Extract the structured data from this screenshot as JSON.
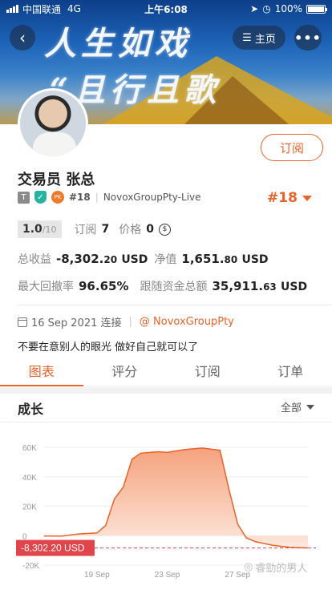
{
  "status_bar": {
    "carrier": "中国联通",
    "network": "4G",
    "time": "上午6:08",
    "battery": "100%"
  },
  "banner": {
    "line1": "人生如戏",
    "line2": "“且行且歌"
  },
  "nav": {
    "home_label": "主页"
  },
  "profile": {
    "subscribe_label": "订阅",
    "name": "交易员  张总",
    "badge_t": "T",
    "badge_pk": "PK",
    "rank_small": "#18",
    "account_type": "NovoxGroupPty-Live",
    "rank_big": "#18"
  },
  "stats": {
    "score": "1.0",
    "score_max": "/10",
    "subscribe_label": "订阅",
    "subscribe_count": "7",
    "price_label": "价格",
    "price_value": "0",
    "total_profit_label": "总收益",
    "total_profit_main": "-8,302.",
    "total_profit_dec": "20",
    "total_profit_unit": "USD",
    "net_value_label": "净值",
    "net_value_main": "1,651.",
    "net_value_dec": "80",
    "net_value_unit": "USD",
    "max_drawdown_label": "最大回撤率",
    "max_drawdown_value": "96.65%",
    "follow_funds_label": "跟随资金总额",
    "follow_funds_main": "35,911.",
    "follow_funds_dec": "63",
    "follow_funds_unit": "USD"
  },
  "connection": {
    "date": "16 Sep 2021 连接",
    "account": "@ NovoxGroupPty"
  },
  "motto": "不要在意别人的眼光 做好自己就可以了",
  "tabs": [
    {
      "label": "图表"
    },
    {
      "label": "评分"
    },
    {
      "label": "订阅"
    },
    {
      "label": "订单"
    }
  ],
  "growth": {
    "title": "成长",
    "filter": "全部"
  },
  "chart_data": {
    "type": "area",
    "y_ticks": [
      "60K",
      "40K",
      "20K",
      "0",
      "-20K"
    ],
    "ylim": [
      -20000,
      60000
    ],
    "x_ticks": [
      "19 Sep",
      "23 Sep",
      "27 Sep"
    ],
    "x_tick_pos": [
      16,
      20,
      24
    ],
    "current_value_label": "-8,302.20 USD",
    "current_value": -8302.2,
    "colors": {
      "line": "#e8622a",
      "fill_top": "#f5a27d",
      "fill_bottom": "#fde8de"
    },
    "x": [
      13,
      14,
      15,
      16,
      16.5,
      17,
      17.5,
      18,
      18.5,
      19,
      19.5,
      20,
      21,
      22,
      23,
      23.5,
      24,
      24.5,
      25,
      26,
      27,
      28
    ],
    "y": [
      -200,
      -300,
      1200,
      1800,
      7000,
      25000,
      33000,
      52000,
      56000,
      56500,
      57000,
      56500,
      58500,
      59500,
      58000,
      32000,
      8000,
      -1500,
      -4000,
      -6500,
      -8000,
      -8302
    ]
  },
  "watermark": "睿勁的男人"
}
